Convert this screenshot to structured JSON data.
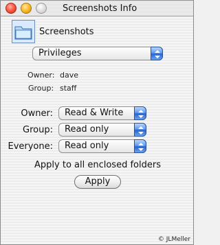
{
  "window": {
    "title": "Screenshots Info"
  },
  "item": {
    "name": "Screenshots",
    "icon": "folder-icon"
  },
  "section_popup": {
    "value": "Privileges"
  },
  "info": {
    "owner_label": "Owner:",
    "owner_value": "dave",
    "group_label": "Group:",
    "group_value": "staff"
  },
  "permissions": {
    "owner_label": "Owner:",
    "owner_value": "Read & Write",
    "group_label": "Group:",
    "group_value": "Read only",
    "everyone_label": "Everyone:",
    "everyone_value": "Read only"
  },
  "apply": {
    "note": "Apply to all enclosed folders",
    "button_label": "Apply"
  },
  "watermark": "© JLMeller",
  "colors": {
    "accent_blue": "#2a66d1"
  }
}
